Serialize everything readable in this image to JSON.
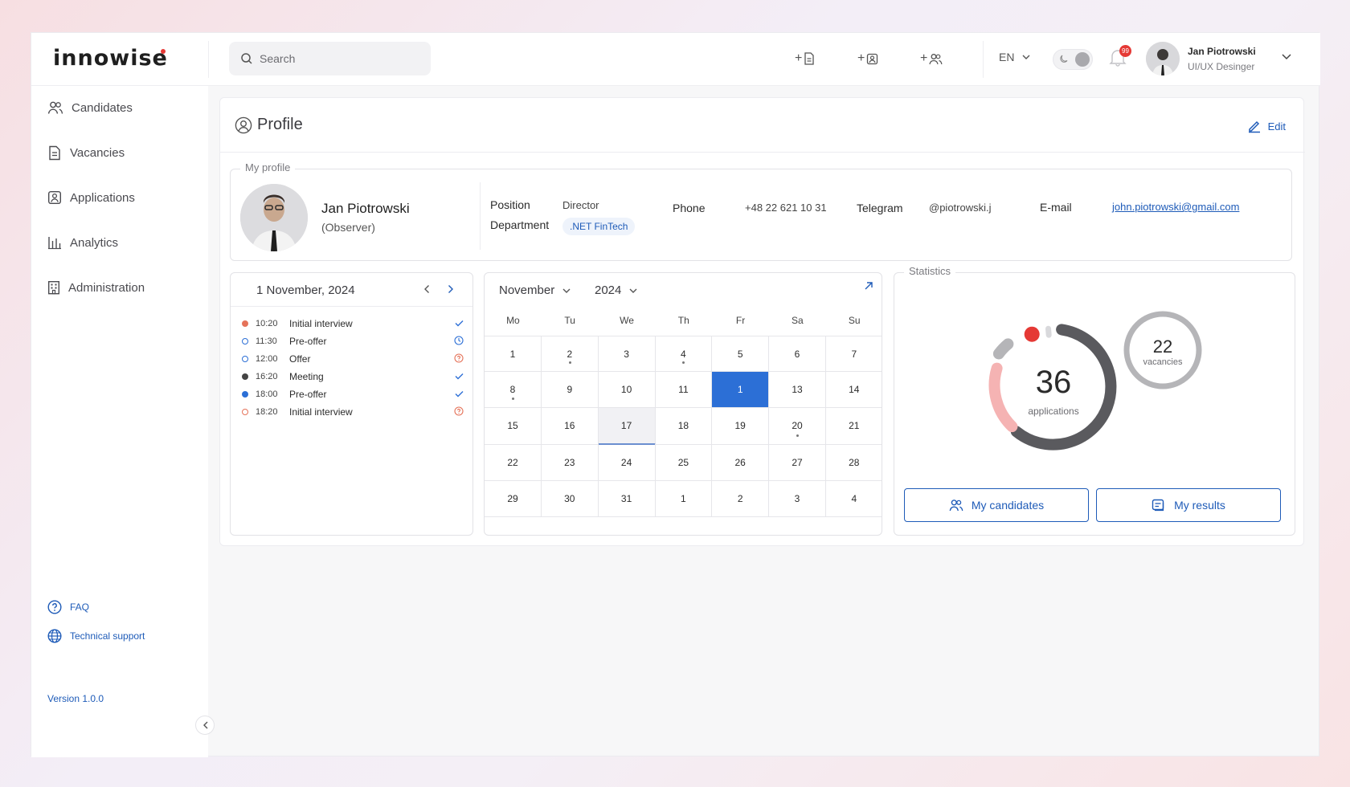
{
  "header": {
    "logo": "innowise",
    "search_placeholder": "Search",
    "quick_actions": [
      "+",
      "+",
      "+"
    ],
    "language": "EN",
    "notifications_count": "99",
    "user": {
      "name": "Jan Piotrowski",
      "role": "UI/UX Desinger"
    }
  },
  "sidebar": {
    "items": [
      {
        "label": "Candidates",
        "icon": "users-icon"
      },
      {
        "label": "Vacancies",
        "icon": "document-icon"
      },
      {
        "label": "Applications",
        "icon": "application-icon"
      },
      {
        "label": "Analytics",
        "icon": "bar-chart-icon"
      },
      {
        "label": "Administration",
        "icon": "building-icon"
      }
    ],
    "faq": "FAQ",
    "support": "Technical support",
    "version": "Version  1.0.0"
  },
  "profile": {
    "title": "Profile",
    "edit_label": "Edit",
    "section_label": "My profile",
    "name": "Jan Piotrowski",
    "role": "(Observer)",
    "position_label": "Position",
    "position": "Director",
    "department_label": "Department",
    "department": ".NET FinTech",
    "phone_label": "Phone",
    "phone": "+48 22 621 10 31",
    "telegram_label": "Telegram",
    "telegram": "@piotrowski.j",
    "email_label": "E-mail",
    "email": "john.piotrowski@gmail.com"
  },
  "schedule": {
    "date": "1 November, 2024",
    "events": [
      {
        "time": "10:20",
        "title": "Initial interview",
        "dot": "#e5735a",
        "dot_style": "filled",
        "status": "check"
      },
      {
        "time": "11:30",
        "title": "Pre-offer",
        "dot": "#2c6fd6",
        "dot_style": "outline",
        "status": "clock"
      },
      {
        "time": "12:00",
        "title": "Offer",
        "dot": "#2c6fd6",
        "dot_style": "outline",
        "status": "question"
      },
      {
        "time": "16:20",
        "title": "Meeting",
        "dot": "#444444",
        "dot_style": "filled",
        "status": "check"
      },
      {
        "time": "18:00",
        "title": "Pre-offer",
        "dot": "#2c6fd6",
        "dot_style": "filled",
        "status": "check"
      },
      {
        "time": "18:20",
        "title": "Initial interview",
        "dot": "#e5735a",
        "dot_style": "outline",
        "status": "question"
      }
    ]
  },
  "calendar": {
    "month": "November",
    "year": "2024",
    "weekdays": [
      "Mo",
      "Tu",
      "We",
      "Th",
      "Fr",
      "Sa",
      "Su"
    ],
    "days": [
      [
        "1",
        "2",
        "3",
        "4",
        "5",
        "6",
        "7"
      ],
      [
        "8",
        "9",
        "10",
        "11",
        "1",
        "13",
        "14"
      ],
      [
        "15",
        "16",
        "17",
        "18",
        "19",
        "20",
        "21"
      ],
      [
        "22",
        "23",
        "24",
        "25",
        "26",
        "27",
        "28"
      ],
      [
        "29",
        "30",
        "31",
        "1",
        "2",
        "3",
        "4"
      ]
    ],
    "selected_cell": [
      1,
      4
    ],
    "today_cell": [
      2,
      2
    ],
    "dot_cells": [
      [
        0,
        1
      ],
      [
        0,
        3
      ],
      [
        1,
        0
      ],
      [
        2,
        5
      ]
    ]
  },
  "statistics": {
    "title": "Statistics",
    "applications_count": "36",
    "applications_label": "applications",
    "vacancies_count": "22",
    "vacancies_label": "vacancies",
    "my_candidates_label": "My candidates",
    "my_results_label": "My results",
    "colors": {
      "dark": "#5a5a5e",
      "pink": "#f5b3b3",
      "gray": "#b5b5b8",
      "red": "#e53935",
      "light": "#d9d9dc"
    }
  },
  "colors": {
    "accent": "#1e5bb8",
    "selected": "#2c6fd6",
    "alert": "#e53935"
  }
}
